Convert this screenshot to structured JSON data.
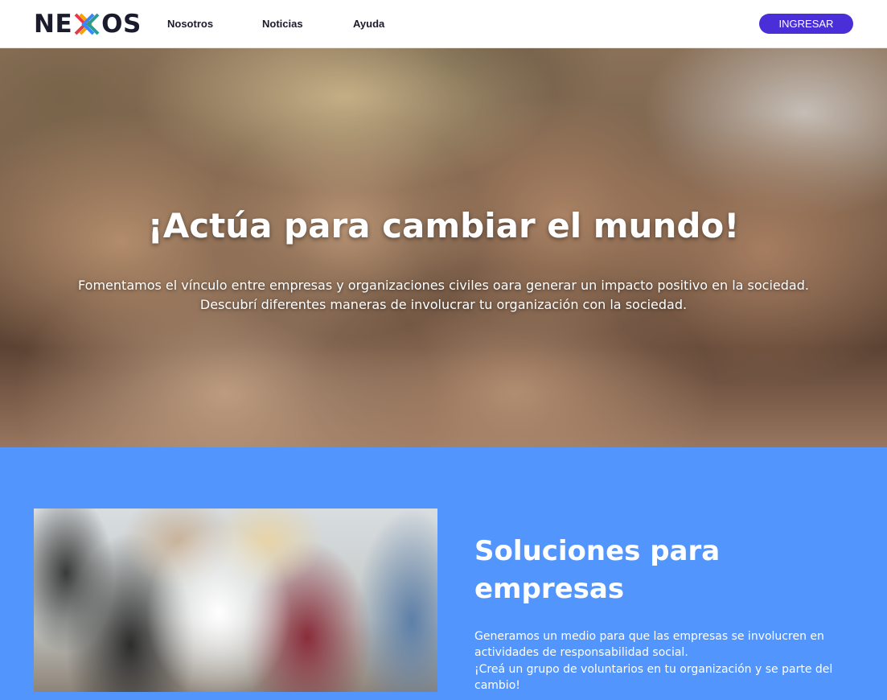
{
  "header": {
    "logo_text_left": "NE",
    "logo_text_right": "OS",
    "nav": [
      {
        "label": "Nosotros"
      },
      {
        "label": "Noticias"
      },
      {
        "label": "Ayuda"
      }
    ],
    "login_label": "INGRESAR"
  },
  "hero": {
    "title": "¡Actúa para cambiar el mundo!",
    "subtitle_line1": "Fomentamos el vínculo entre empresas y organizaciones civiles oara generar un impacto positivo en la sociedad.",
    "subtitle_line2": "Descubrí diferentes maneras de involucrar tu organización con la sociedad."
  },
  "solutions": {
    "title": "Soluciones para empresas",
    "paragraph1": "Generamos un medio para que las empresas se involucren en actividades de responsabilidad social.",
    "paragraph2": "¡Creá un grupo de voluntarios en tu organización y se parte del cambio!"
  },
  "colors": {
    "brand_accent": "#4a2fd8",
    "section_blue": "#5295fc",
    "logo_dark": "#1b1b2e"
  }
}
